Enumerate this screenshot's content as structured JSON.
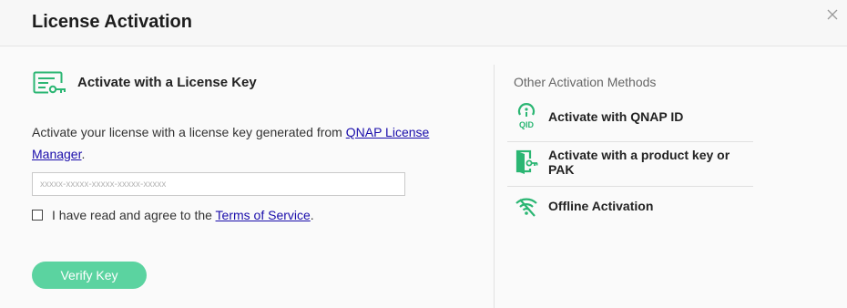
{
  "dialog": {
    "title": "License Activation"
  },
  "left": {
    "heading": "Activate with a License Key",
    "description_before": "Activate your license with a license key generated from ",
    "description_link": "QNAP License Manager",
    "description_after": ".",
    "key_input": {
      "placeholder": "xxxxx-xxxxx-xxxxx-xxxxx-xxxxx",
      "value": ""
    },
    "agree": {
      "text_before": "I have read and agree to the ",
      "link": "Terms of Service",
      "text_after": ".",
      "checked": false
    },
    "verify_button": "Verify Key"
  },
  "right": {
    "title": "Other Activation Methods",
    "methods": [
      {
        "label": "Activate with QNAP ID",
        "icon": "qnap-id-icon"
      },
      {
        "label": "Activate with a product key or PAK",
        "icon": "door-key-icon"
      },
      {
        "label": "Offline Activation",
        "icon": "wifi-off-icon"
      }
    ]
  },
  "colors": {
    "accent": "#2bb673",
    "button": "#5bd3a0",
    "link": "#1a0dab"
  }
}
